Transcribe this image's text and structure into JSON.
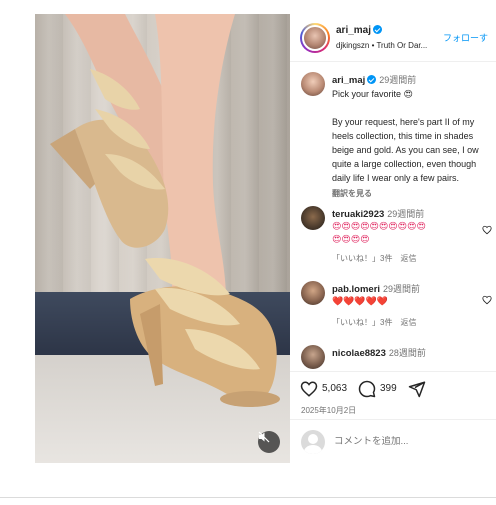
{
  "post": {
    "media_label": "Photo of gold feather-trimmed high-heel sandals",
    "mute_icon": "speaker-muted-icon"
  },
  "header": {
    "username": "ari_maj",
    "follow_label": "フォローす",
    "subtitle": "djkingszn • Truth Or Dar..."
  },
  "caption": {
    "username": "ari_maj",
    "time": "29週間前",
    "lines": [
      "Pick your favorite 😍",
      "",
      "By your request, here's part II of my",
      "heels collection, this time in shades",
      "beige and gold. As you can see, I ow",
      "quite a large collection, even though",
      "daily life I wear only a few pairs."
    ],
    "translate_label": "翻訳を見る"
  },
  "comments": [
    {
      "username": "teruaki2923",
      "time": "29週間前",
      "emoji_line1": "😍😍😍😍😍😍😍😍😍😍",
      "emoji_line2": "😍😍😍😍",
      "likes": "「いいね！」3件",
      "reply": "返信"
    },
    {
      "username": "pab.lomeri",
      "time": "29週間前",
      "emoji_line1": "❤️❤️❤️❤️❤️",
      "likes": "「いいね！」3件",
      "reply": "返信"
    },
    {
      "username": "nicolae8823",
      "time": "28週間前"
    }
  ],
  "actions": {
    "like_count": "5,063",
    "comment_count": "399",
    "date": "2025年10月2日"
  },
  "composer": {
    "placeholder": "コメントを追加..."
  },
  "colors": {
    "accent": "#0095f6",
    "muted_text": "#737373",
    "heart": "#ed4956"
  }
}
